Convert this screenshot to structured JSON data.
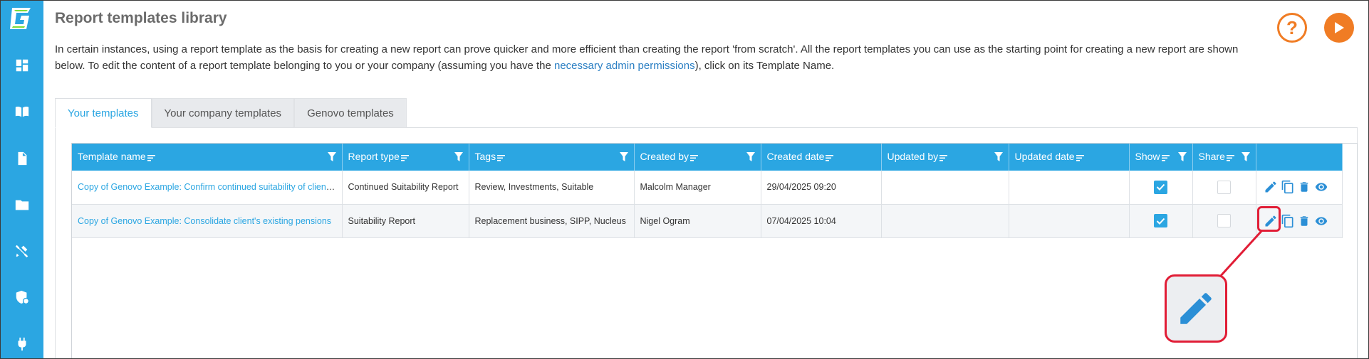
{
  "page": {
    "title": "Report templates library",
    "intro_part1": "In certain instances, using a report template as the basis for creating a new report can prove quicker and more efficient than creating the report 'from scratch'. All the report templates you can use as the starting point for creating a new report are shown below. To edit the content of a report template belonging to you or your company (assuming you have the ",
    "intro_link": "necessary admin permissions",
    "intro_part2": "), click on its Template Name."
  },
  "top_buttons": {
    "help_glyph": "?"
  },
  "colors": {
    "accent": "#2ba6e2",
    "orange": "#f07c24",
    "highlight_red": "#e11d36",
    "link": "#2b7fc3"
  },
  "sidebar": {
    "items": [
      {
        "icon": "dashboard-icon"
      },
      {
        "icon": "book-open-icon"
      },
      {
        "icon": "document-icon"
      },
      {
        "icon": "folder-icon"
      },
      {
        "icon": "tools-icon"
      },
      {
        "icon": "shield-user-icon"
      },
      {
        "icon": "plug-icon"
      }
    ]
  },
  "tabs": [
    {
      "label": "Your templates",
      "active": true
    },
    {
      "label": "Your company templates",
      "active": false
    },
    {
      "label": "Genovo templates",
      "active": false
    }
  ],
  "table": {
    "columns": [
      {
        "label": "Template name",
        "filter": true
      },
      {
        "label": "Report type",
        "filter": true
      },
      {
        "label": "Tags",
        "filter": true
      },
      {
        "label": "Created by",
        "filter": true
      },
      {
        "label": "Created date",
        "filter": false
      },
      {
        "label": "Updated by",
        "filter": true
      },
      {
        "label": "Updated date",
        "filter": false
      },
      {
        "label": "Show",
        "filter": true
      },
      {
        "label": "Share",
        "filter": true
      },
      {
        "label": "",
        "filter": false
      }
    ],
    "rows": [
      {
        "template_name": "Copy of Genovo Example: Confirm continued suitability of client's existing arrangements",
        "report_type": "Continued Suitability Report",
        "tags": "Review, Investments, Suitable",
        "created_by": "Malcolm Manager",
        "created_date": "29/04/2025 09:20",
        "updated_by": "",
        "updated_date": "",
        "show": true,
        "share": false
      },
      {
        "template_name": "Copy of Genovo Example: Consolidate client's existing pensions",
        "report_type": "Suitability Report",
        "tags": "Replacement business, SIPP, Nucleus",
        "created_by": "Nigel Ogram",
        "created_date": "07/04/2025 10:04",
        "updated_by": "",
        "updated_date": "",
        "show": true,
        "share": false
      }
    ],
    "row_actions": [
      "edit-icon",
      "copy-icon",
      "delete-icon",
      "view-icon"
    ]
  }
}
